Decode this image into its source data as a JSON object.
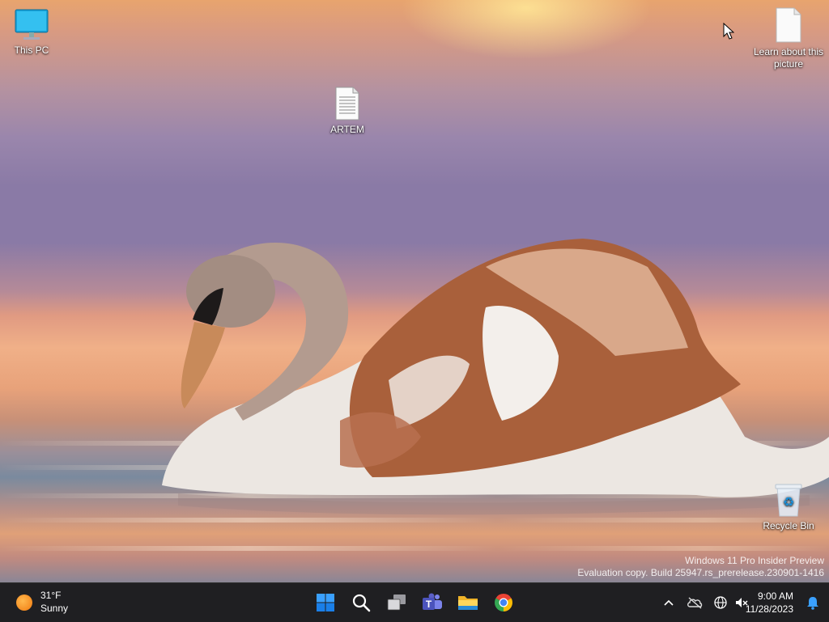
{
  "desktop": {
    "icons": [
      {
        "label": "This PC",
        "icon": "monitor-icon"
      },
      {
        "label": "ARTEM",
        "icon": "text-file-icon"
      },
      {
        "label": "Learn about this picture",
        "icon": "blank-file-icon"
      },
      {
        "label": "Recycle Bin",
        "icon": "recycle-bin-icon"
      }
    ],
    "watermark": {
      "line1": "Windows 11 Pro Insider Preview",
      "line2": "Evaluation copy. Build 25947.rs_prerelease.230901-1416"
    }
  },
  "taskbar": {
    "weather": {
      "temperature": "31°F",
      "condition": "Sunny",
      "icon": "sun-icon"
    },
    "apps": [
      {
        "name": "start",
        "icon": "windows-logo-icon",
        "color": "#0a84ff"
      },
      {
        "name": "search",
        "icon": "search-icon"
      },
      {
        "name": "task-view",
        "icon": "task-view-icon"
      },
      {
        "name": "teams",
        "icon": "teams-icon",
        "color": "#5b5fc7"
      },
      {
        "name": "file-explorer",
        "icon": "folder-icon",
        "color": "#f5c33b"
      },
      {
        "name": "chrome",
        "icon": "chrome-icon"
      }
    ],
    "tray": {
      "icons": [
        "chevron-up-icon",
        "onedrive-offline-icon",
        "network-globe-icon",
        "volume-muted-icon"
      ],
      "time": "9:00 AM",
      "date": "11/28/2023",
      "notification_icon": "bell-icon"
    }
  }
}
